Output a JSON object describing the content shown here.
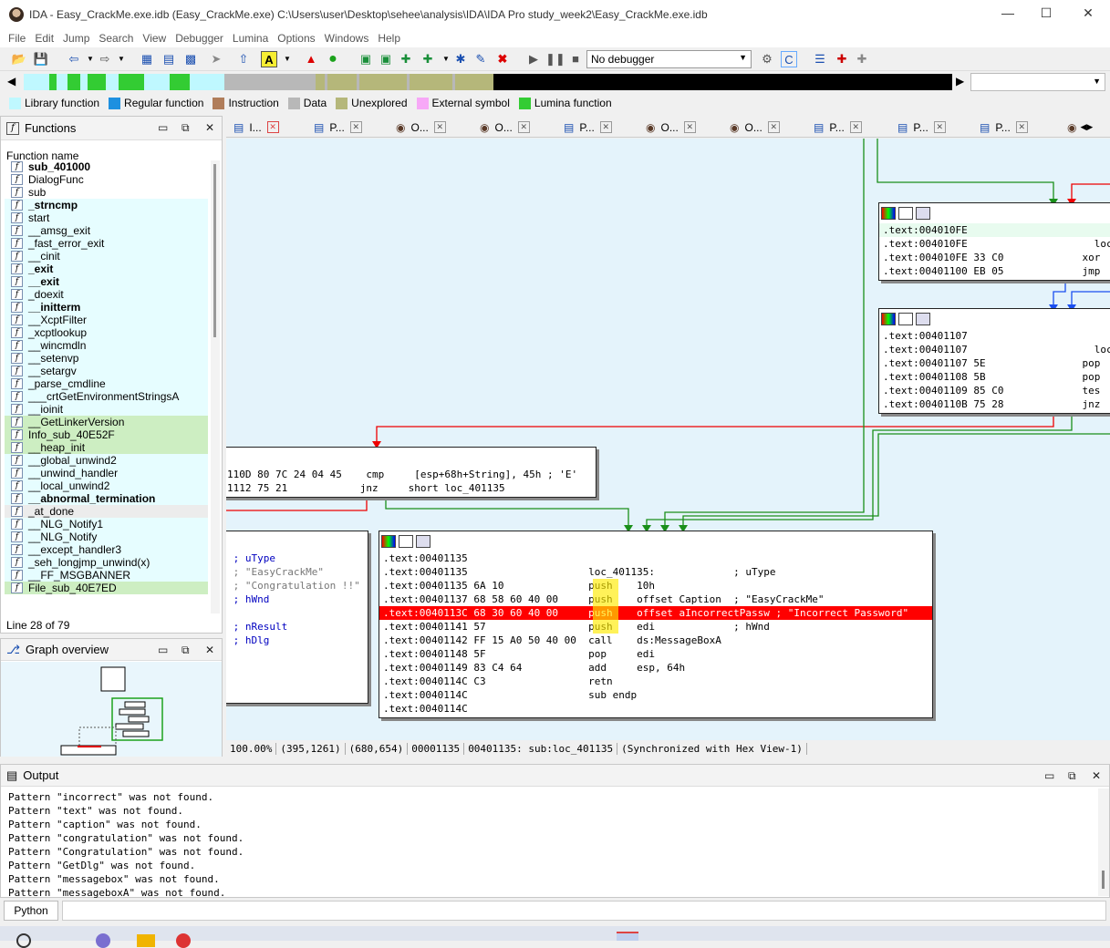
{
  "title": "IDA - Easy_CrackMe.exe.idb (Easy_CrackMe.exe) C:\\Users\\user\\Desktop\\sehee\\analysis\\IDA\\IDA Pro study_week2\\Easy_CrackMe.exe.idb",
  "menu": [
    "File",
    "Edit",
    "Jump",
    "Search",
    "View",
    "Debugger",
    "Lumina",
    "Options",
    "Windows",
    "Help"
  ],
  "debugger_select": "No debugger",
  "legend": [
    {
      "label": "Library function",
      "color": "#bff8ff"
    },
    {
      "label": "Regular function",
      "color": "#1e90e0"
    },
    {
      "label": "Instruction",
      "color": "#b07d5a"
    },
    {
      "label": "Data",
      "color": "#b8b8b8"
    },
    {
      "label": "Unexplored",
      "color": "#b5b77a"
    },
    {
      "label": "External symbol",
      "color": "#f7a8f7"
    },
    {
      "label": "Lumina function",
      "color": "#33cc33"
    }
  ],
  "functions": {
    "title": "Functions",
    "column": "Function name",
    "items": [
      "sub_401000",
      "DialogFunc",
      "sub",
      "_strncmp",
      "start",
      "__amsg_exit",
      "_fast_error_exit",
      "__cinit",
      "_exit",
      "__exit",
      "_doexit",
      "__initterm",
      "__XcptFilter",
      "_xcptlookup",
      "__wincmdln",
      "__setenvp",
      "__setargv",
      "_parse_cmdline",
      "___crtGetEnvironmentStringsA",
      "__ioinit",
      "__GetLinkerVersion",
      "Info_sub_40E52F",
      "__heap_init",
      "__global_unwind2",
      "__unwind_handler",
      "__local_unwind2",
      "__abnormal_termination",
      "_at_done",
      "__NLG_Notify1",
      "__NLG_Notify",
      "__except_handler3",
      "_seh_longjmp_unwind(x)",
      "__FF_MSGBANNER",
      "File_sub_40E7ED"
    ],
    "status": "Line 28 of 79"
  },
  "graph_overview": {
    "title": "Graph overview"
  },
  "tabs": [
    "I...",
    "P...",
    "O...",
    "O...",
    "P...",
    "O...",
    "O...",
    "P...",
    "P...",
    "P..."
  ],
  "nodes": {
    "n1": [
      ".text:004010FE",
      ".text:004010FE                     loc",
      ".text:004010FE 33 C0             xor",
      ".text:00401100 EB 05             jmp"
    ],
    "n2": [
      ".text:00401107",
      ".text:00401107                     loc",
      ".text:00401107 5E                pop",
      ".text:00401108 5B                pop",
      ".text:00401109 85 C0             tes",
      ".text:0040110B 75 28             jnz"
    ],
    "n3": [
      "110D 80 7C 24 04 45    cmp     [esp+68h+String], 45h ; 'E'",
      "1112 75 21            jnz     short loc_401135"
    ],
    "n4": [
      " ; uType",
      " ; \"EasyCrackMe\"",
      " ; \"Congratulation !!\"",
      " ; hWnd",
      "",
      " ; nResult",
      " ; hDlg"
    ],
    "main": [
      ".text:00401135",
      ".text:00401135                    loc_401135:             ; uType",
      ".text:00401135 6A 10              push    10h",
      ".text:00401137 68 58 60 40 00     push    offset Caption  ; \"EasyCrackMe\"",
      ".text:0040113C 68 30 60 40 00     push    offset aIncorrectPassw ; \"Incorrect Password\"",
      ".text:00401141 57                 push    edi             ; hWnd",
      ".text:00401142 FF 15 A0 50 40 00  call    ds:MessageBoxA",
      ".text:00401148 5F                 pop     edi",
      ".text:00401149 83 C4 64           add     esp, 64h",
      ".text:0040114C C3                 retn",
      ".text:0040114C                    sub endp",
      ".text:0040114C"
    ]
  },
  "status": [
    "100.00%",
    "(395,1261)",
    "(680,654)",
    "00001135",
    "00401135: sub:loc_401135",
    "(Synchronized with Hex View-1)"
  ],
  "output": {
    "title": "Output",
    "lines": [
      "Pattern \"incorrect\" was not found.",
      "Pattern \"text\" was not found.",
      "Pattern \"caption\" was not found.",
      "Pattern \"congratulation\" was not found.",
      "Pattern \"Congratulation\" was not found.",
      "Pattern \"GetDlg\" was not found.",
      "Pattern \"messagebox\" was not found.",
      "Pattern \"messageboxA\" was not found."
    ]
  },
  "python_label": "Python"
}
